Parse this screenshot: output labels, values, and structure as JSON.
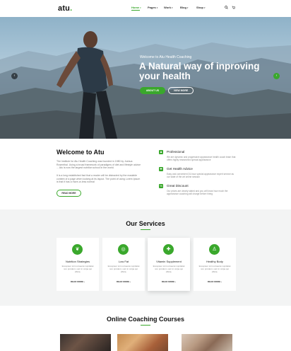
{
  "header": {
    "logo_text": "atu",
    "logo_dot": ".",
    "nav": [
      {
        "label": "Home"
      },
      {
        "label": "Pages"
      },
      {
        "label": "Work"
      },
      {
        "label": "Blog"
      },
      {
        "label": "Shop"
      }
    ],
    "search_icon": "search-icon",
    "cart_icon": "cart-icon"
  },
  "hero": {
    "subtitle": "Welcome to Atu Health Coaching",
    "title": "A Natural way of inproving your health",
    "about_button": "ABOUT US",
    "view_button": "VIEW MORE",
    "prev_icon": "chevron-left-icon",
    "next_icon": "chevron-right-icon"
  },
  "welcome": {
    "title": "Welcome to Atu",
    "p1": "The Institute for Atu Health Coaching was founded in 1980 by Joshua Rosenthal. Using a broad framework of paradigms of diet and lifestyle advice ... Atu is now the largest nutrition school in the world.",
    "p2": "It is a long established fact that a reader will be distracted by the readable content of a page when looking at its layout. The point of using Lorem Ipsum is that it has a more-or-less normal",
    "read_more": "READ MORE",
    "features": [
      {
        "title": "Professional",
        "desc": "We are dynamic and progressive appearance health coach team that offers highly researched special appearance"
      },
      {
        "title": "Get Health Advice",
        "desc": "Easy and convenient 24-hour special appearance expert service as our state of the art online session"
      },
      {
        "title": "Great Discount",
        "desc": "Our prices are clearly stated and you will know how much the appearance coaching will charge before hiring"
      }
    ]
  },
  "services": {
    "title": "Our Services",
    "cards": [
      {
        "title": "Nutrition Strategies",
        "desc": "Excepteur sint occaecat cupidatat non proident, sunt in culpa qui officia.",
        "more": "READ MORE"
      },
      {
        "title": "Low Fat",
        "desc": "Excepteur sint occaecat cupidatat non proident, sunt in culpa qui officia.",
        "more": "READ MORE"
      },
      {
        "title": "Vitamin Supplement",
        "desc": "Excepteur sint occaecat cupidatat non proident, sunt in culpa qui officia.",
        "more": "READ MORE"
      },
      {
        "title": "Healthy Body",
        "desc": "Excepteur sint occaecat cupidatat non proident, sunt in culpa qui officia.",
        "more": "READ MORE"
      }
    ]
  },
  "courses": {
    "title": "Online Coaching Courses"
  },
  "colors": {
    "accent": "#3aa82c"
  }
}
